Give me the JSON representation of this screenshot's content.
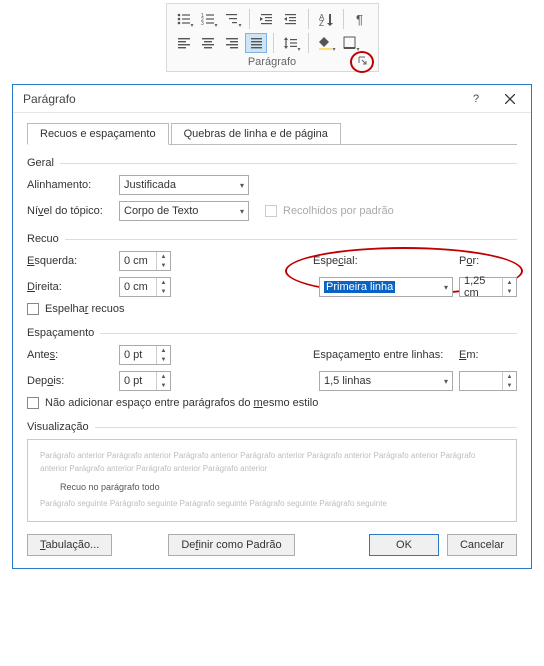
{
  "ribbon": {
    "group_label": "Parágrafo"
  },
  "dialog": {
    "title": "Parágrafo",
    "tabs": {
      "spacing": "Recuos e espaçamento",
      "breaks": "Quebras de linha e de página"
    },
    "group_geral": "Geral",
    "alignment_label": "Alinhamento:",
    "alignment_value": "Justificada",
    "outline_label": "Nível do tópico:",
    "outline_value": "Corpo de Texto",
    "collapsed_label": "Recolhidos por padrão",
    "group_recuo": "Recuo",
    "left_label": "Esquerda:",
    "left_value": "0 cm",
    "right_label": "Direita:",
    "right_value": "0 cm",
    "special_label": "Especial:",
    "special_value": "Primeira linha",
    "by_label": "Por:",
    "by_value": "1,25 cm",
    "mirror_label": "Espelhar recuos",
    "group_espac": "Espaçamento",
    "before_label": "Antes:",
    "before_value": "0 pt",
    "after_label": "Depois:",
    "after_value": "0 pt",
    "line_spacing_label": "Espaçamento entre linhas:",
    "line_spacing_value": "1,5 linhas",
    "at_label": "Em:",
    "at_value": "",
    "noadd_label": "Não adicionar espaço entre parágrafos do mesmo estilo",
    "group_vis": "Visualização",
    "preview_prev": "Parágrafo anterior Parágrafo anterior Parágrafo anterior Parágrafo anterior Parágrafo anterior Parágrafo anterior Parágrafo anterior Parágrafo anterior Parágrafo anterior Parágrafo anterior",
    "preview_sample": "Recuo no parágrafo todo",
    "preview_next": "Parágrafo seguinte Parágrafo seguinte Parágrafo seguinte Parágrafo seguinte Parágrafo seguinte",
    "btn_tabs": "Tabulação...",
    "btn_default": "Definir como Padrão",
    "btn_ok": "OK",
    "btn_cancel": "Cancelar"
  }
}
